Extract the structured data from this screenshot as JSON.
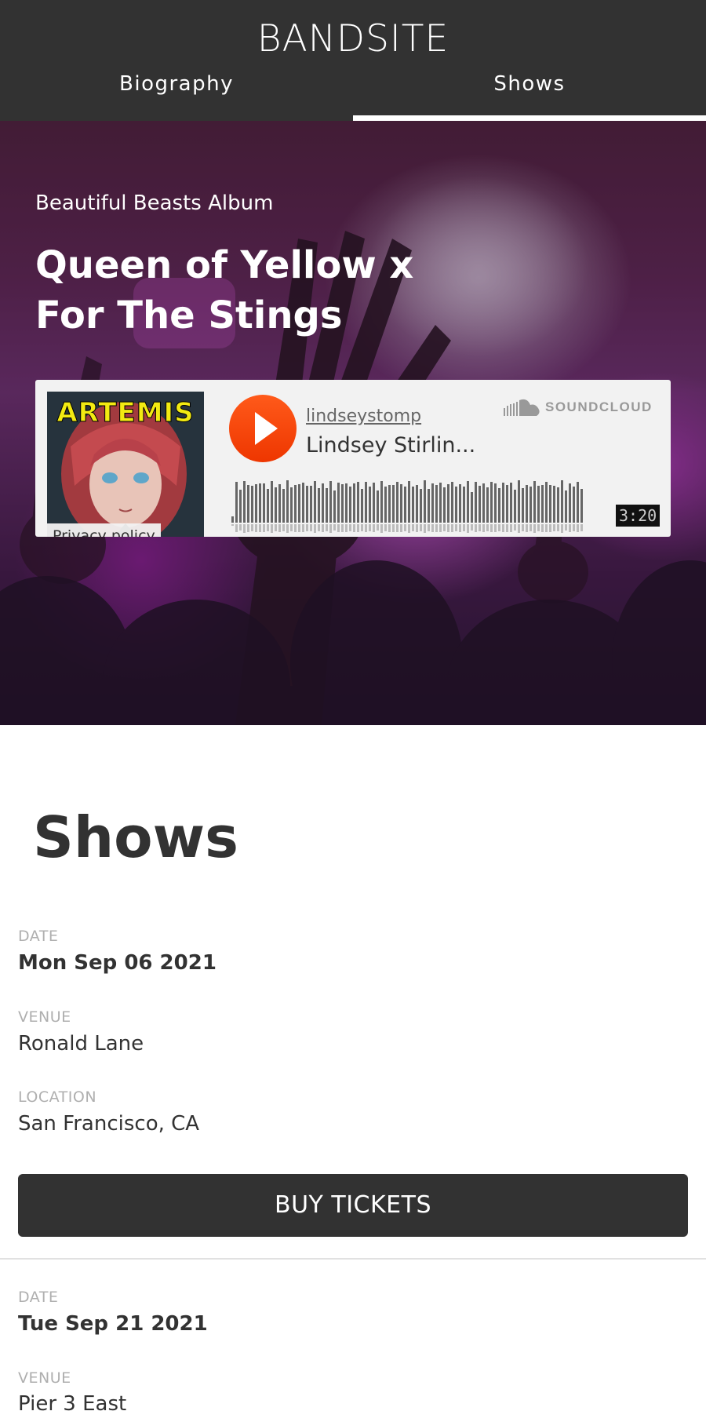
{
  "header": {
    "logo": "BANDSITE",
    "nav": [
      {
        "label": "Biography",
        "active": false
      },
      {
        "label": "Shows",
        "active": true
      }
    ]
  },
  "hero": {
    "subtitle": "Beautiful Beasts Album",
    "title": "Queen of Yellow x For The Stings"
  },
  "player": {
    "artwork_text": "ARTEMIS",
    "privacy_label": "Privacy policy",
    "user": "lindseystomp",
    "track": "Lindsey Stirlin...",
    "brand": "SOUNDCLOUD",
    "duration": "3:20",
    "accent_color": "#ff5500"
  },
  "shows": {
    "heading": "Shows",
    "labels": {
      "date": "DATE",
      "venue": "VENUE",
      "location": "LOCATION"
    },
    "button_label": "BUY TICKETS",
    "items": [
      {
        "date": "Mon Sep 06 2021",
        "venue": "Ronald Lane",
        "location": "San Francisco, CA"
      },
      {
        "date": "Tue Sep 21 2021",
        "venue": "Pier 3 East",
        "location": ""
      }
    ]
  },
  "colors": {
    "header_bg": "#323232",
    "text": "#323232",
    "label": "#afafaf",
    "divider": "#e1e1e1"
  }
}
